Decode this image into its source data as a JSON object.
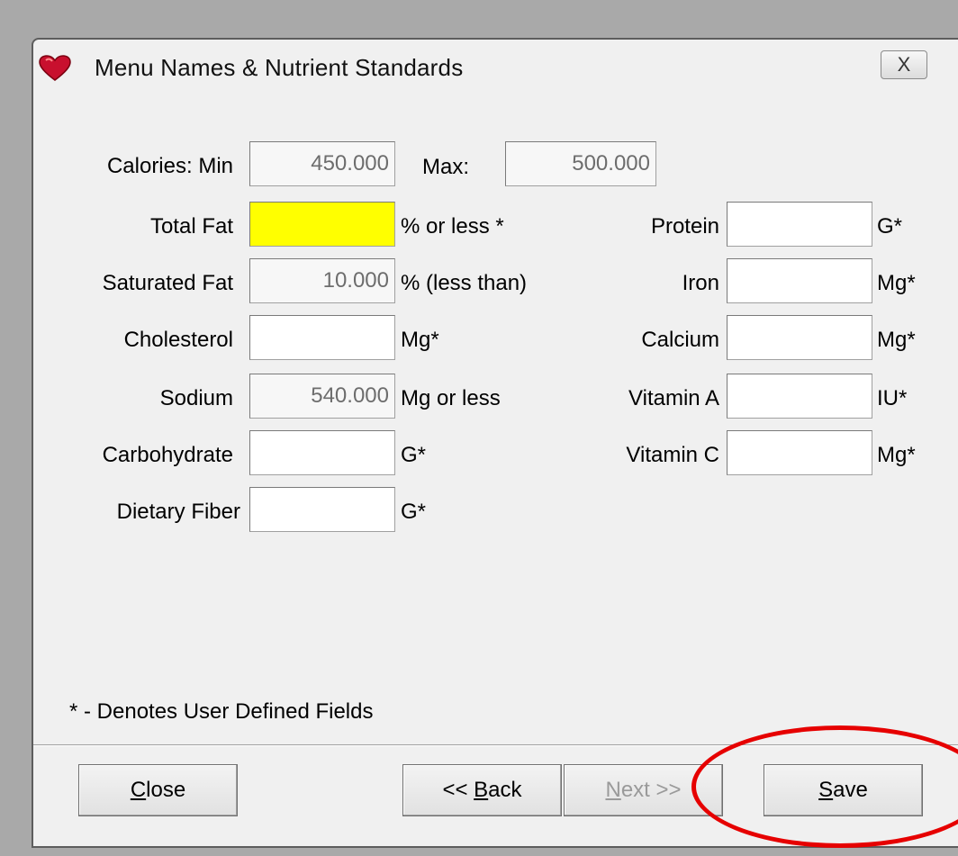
{
  "window": {
    "title": "Menu Names & Nutrient Standards",
    "close_glyph": "X",
    "icon": "heart-icon"
  },
  "form": {
    "calories": {
      "label": "Calories: Min",
      "min_value": "450.000",
      "max_label": "Max:",
      "max_value": "500.000"
    },
    "left": [
      {
        "label": "Total Fat",
        "value": "",
        "unit": "% or less *"
      },
      {
        "label": "Saturated Fat",
        "value": "10.000",
        "unit": "% (less than)"
      },
      {
        "label": "Cholesterol",
        "value": "",
        "unit": "Mg*"
      },
      {
        "label": "Sodium",
        "value": "540.000",
        "unit": "Mg or less"
      },
      {
        "label": "Carbohydrate",
        "value": "",
        "unit": "G*"
      },
      {
        "label": "Dietary Fiber",
        "value": "",
        "unit": "G*"
      }
    ],
    "right": [
      {
        "label": "Protein",
        "value": "",
        "unit": "G*"
      },
      {
        "label": "Iron",
        "value": "",
        "unit": "Mg*"
      },
      {
        "label": "Calcium",
        "value": "",
        "unit": "Mg*"
      },
      {
        "label": "Vitamin A",
        "value": "",
        "unit": "IU*"
      },
      {
        "label": "Vitamin C",
        "value": "",
        "unit": "Mg*"
      }
    ],
    "footnote": "* - Denotes User Defined Fields"
  },
  "buttons": {
    "close": {
      "pre": "",
      "ul": "C",
      "post": "lose"
    },
    "back": {
      "pre": "<< ",
      "ul": "B",
      "post": "ack"
    },
    "next": {
      "pre": "",
      "ul": "N",
      "post": "ext >>"
    },
    "save": {
      "pre": "",
      "ul": "S",
      "post": "ave"
    }
  },
  "colors": {
    "highlight_field": "#ffff00",
    "annotation_circle": "#e60000"
  }
}
